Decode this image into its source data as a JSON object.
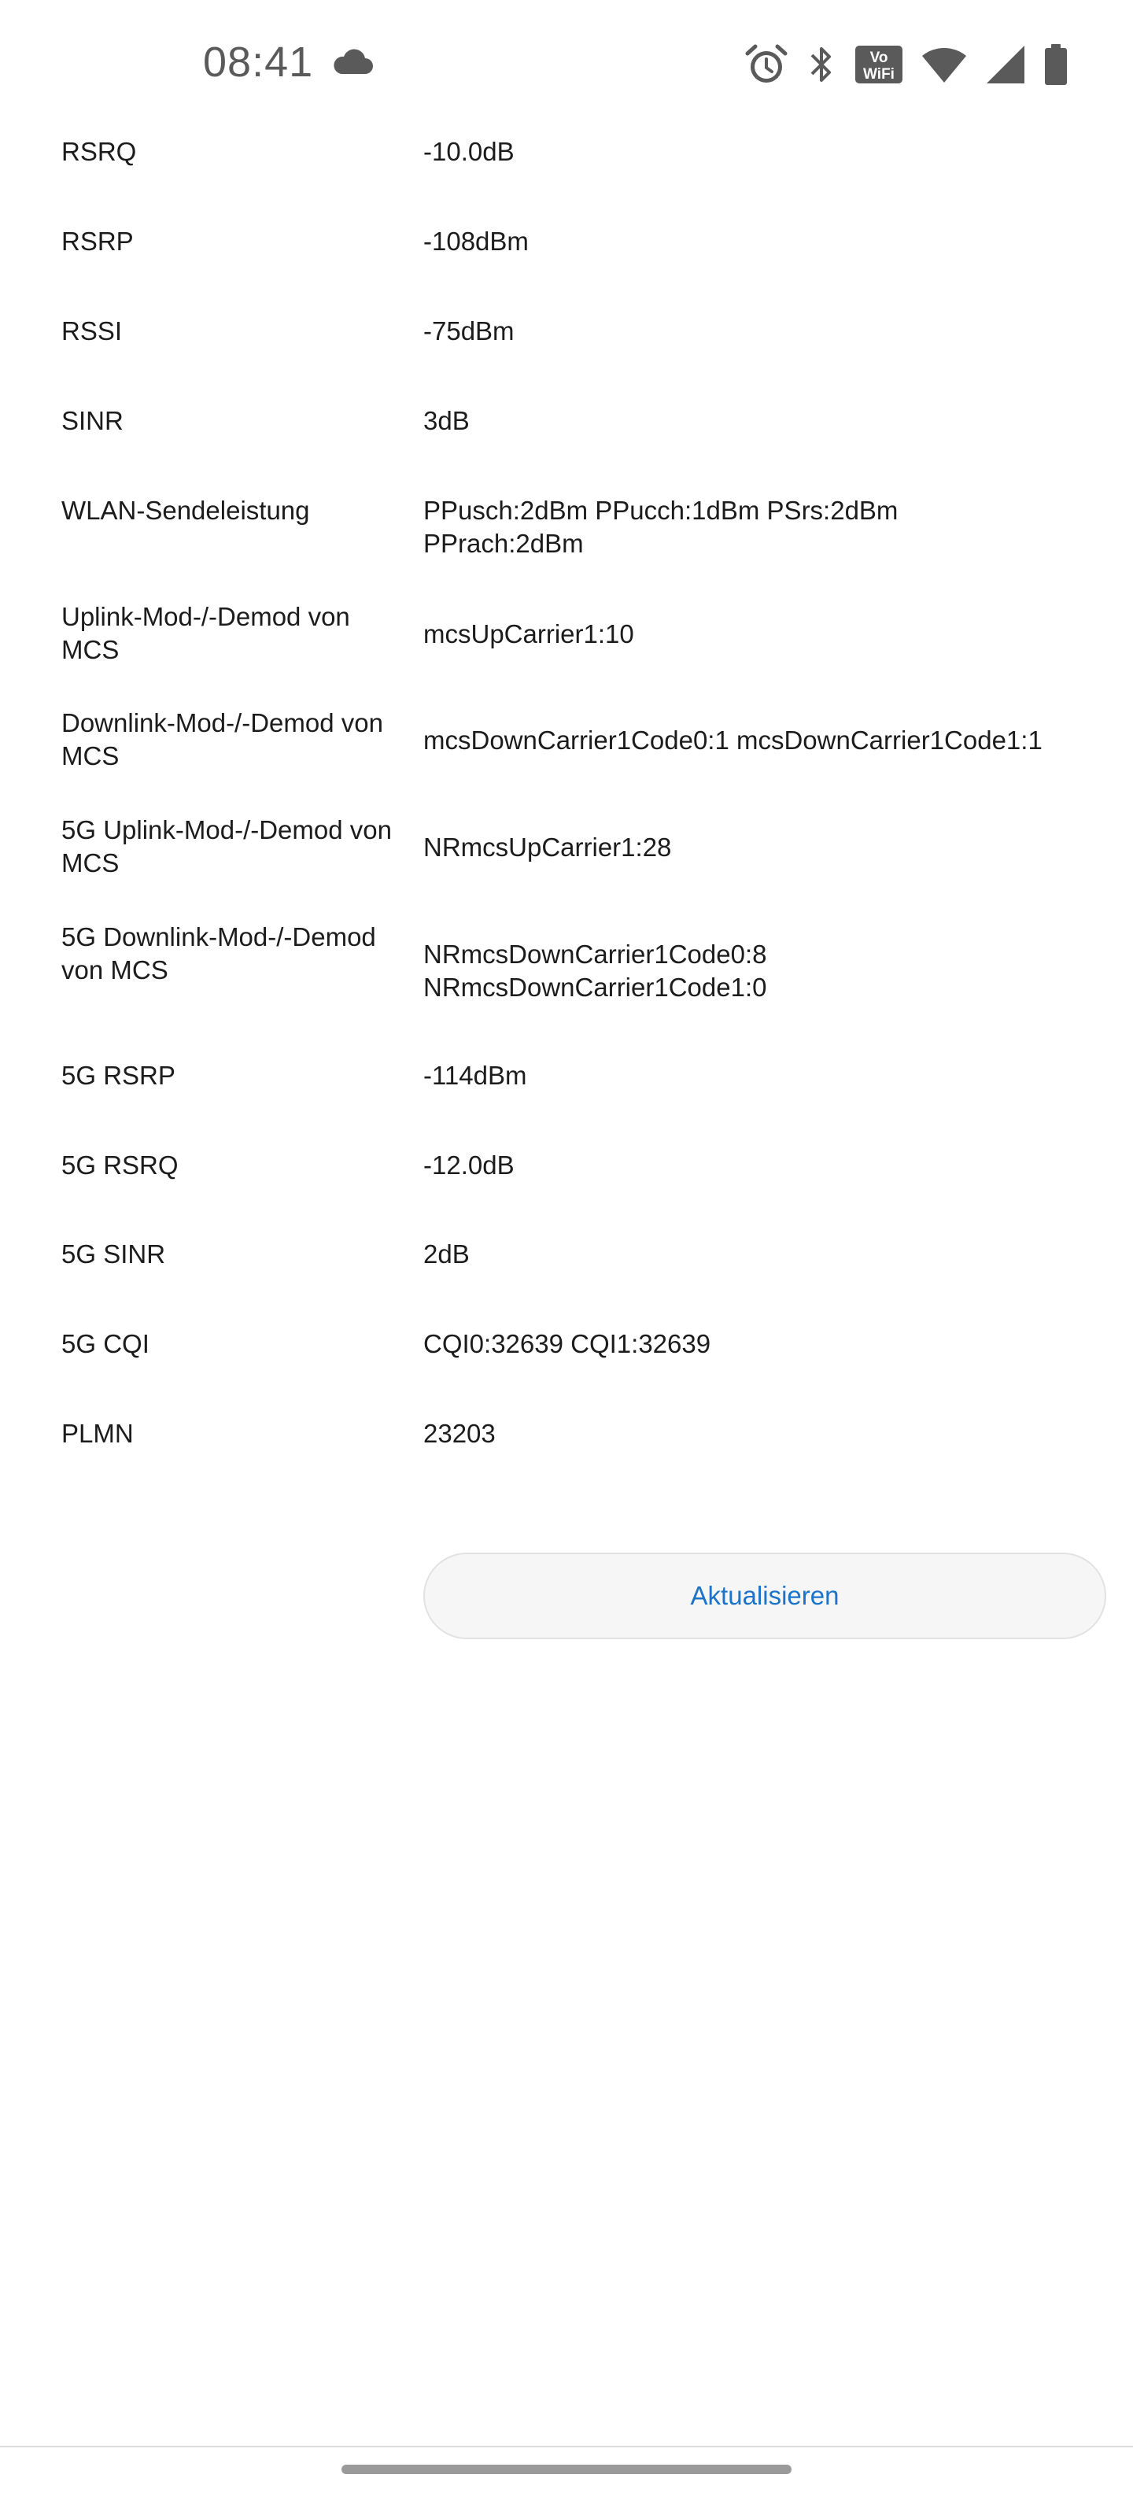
{
  "status_bar": {
    "time": "08:41",
    "left_icons": [
      "cloud-icon"
    ],
    "right_icons": [
      "alarm-icon",
      "bluetooth-icon",
      "vowifi-icon",
      "wifi-icon",
      "cellular-signal-icon",
      "battery-icon"
    ],
    "vowifi_top": "Vo",
    "vowifi_bottom": "WiFi"
  },
  "info": {
    "rows": [
      {
        "label": "RSRQ",
        "value": "-10.0dB"
      },
      {
        "label": "RSRP",
        "value": "-108dBm"
      },
      {
        "label": "RSSI",
        "value": "-75dBm"
      },
      {
        "label": "SINR",
        "value": "3dB"
      },
      {
        "label": "WLAN-Sendeleistung",
        "value": "PPusch:2dBm PPucch:1dBm PSrs:2dBm PPrach:2dBm"
      },
      {
        "label": "Uplink-Mod-/-Demod von MCS",
        "value": "mcsUpCarrier1:10"
      },
      {
        "label": "Downlink-Mod-/-Demod von MCS",
        "value": "mcsDownCarrier1Code0:1 mcsDownCarrier1Code1:1"
      },
      {
        "label": "5G Uplink-Mod-/-Demod von MCS",
        "value": "NRmcsUpCarrier1:28"
      },
      {
        "label": "5G Downlink-Mod-/-Demod von MCS",
        "value": "NRmcsDownCarrier1Code0:8 NRmcsDownCarrier1Code1:0"
      },
      {
        "label": "5G RSRP",
        "value": "-114dBm"
      },
      {
        "label": "5G RSRQ",
        "value": "-12.0dB"
      },
      {
        "label": "5G SINR",
        "value": "2dB"
      },
      {
        "label": "5G CQI",
        "value": "CQI0:32639 CQI1:32639"
      },
      {
        "label": "PLMN",
        "value": "23203"
      }
    ]
  },
  "actions": {
    "refresh_label": "Aktualisieren"
  },
  "colors": {
    "accent": "#1b74c9",
    "text": "#1c1c1c",
    "status_text": "#5a5a5a",
    "button_bg": "#f6f6f6",
    "button_border": "#e2e2e2"
  }
}
